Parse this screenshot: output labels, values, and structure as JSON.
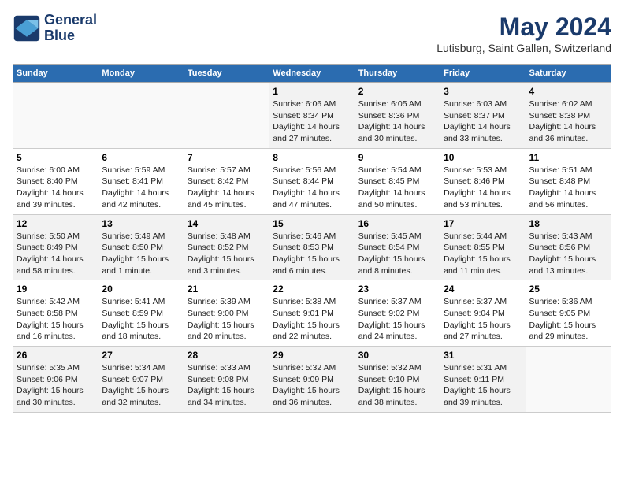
{
  "header": {
    "logo_line1": "General",
    "logo_line2": "Blue",
    "title": "May 2024",
    "subtitle": "Lutisburg, Saint Gallen, Switzerland"
  },
  "days_of_week": [
    "Sunday",
    "Monday",
    "Tuesday",
    "Wednesday",
    "Thursday",
    "Friday",
    "Saturday"
  ],
  "weeks": [
    [
      {
        "day": "",
        "info": ""
      },
      {
        "day": "",
        "info": ""
      },
      {
        "day": "",
        "info": ""
      },
      {
        "day": "1",
        "info": "Sunrise: 6:06 AM\nSunset: 8:34 PM\nDaylight: 14 hours\nand 27 minutes."
      },
      {
        "day": "2",
        "info": "Sunrise: 6:05 AM\nSunset: 8:36 PM\nDaylight: 14 hours\nand 30 minutes."
      },
      {
        "day": "3",
        "info": "Sunrise: 6:03 AM\nSunset: 8:37 PM\nDaylight: 14 hours\nand 33 minutes."
      },
      {
        "day": "4",
        "info": "Sunrise: 6:02 AM\nSunset: 8:38 PM\nDaylight: 14 hours\nand 36 minutes."
      }
    ],
    [
      {
        "day": "5",
        "info": "Sunrise: 6:00 AM\nSunset: 8:40 PM\nDaylight: 14 hours\nand 39 minutes."
      },
      {
        "day": "6",
        "info": "Sunrise: 5:59 AM\nSunset: 8:41 PM\nDaylight: 14 hours\nand 42 minutes."
      },
      {
        "day": "7",
        "info": "Sunrise: 5:57 AM\nSunset: 8:42 PM\nDaylight: 14 hours\nand 45 minutes."
      },
      {
        "day": "8",
        "info": "Sunrise: 5:56 AM\nSunset: 8:44 PM\nDaylight: 14 hours\nand 47 minutes."
      },
      {
        "day": "9",
        "info": "Sunrise: 5:54 AM\nSunset: 8:45 PM\nDaylight: 14 hours\nand 50 minutes."
      },
      {
        "day": "10",
        "info": "Sunrise: 5:53 AM\nSunset: 8:46 PM\nDaylight: 14 hours\nand 53 minutes."
      },
      {
        "day": "11",
        "info": "Sunrise: 5:51 AM\nSunset: 8:48 PM\nDaylight: 14 hours\nand 56 minutes."
      }
    ],
    [
      {
        "day": "12",
        "info": "Sunrise: 5:50 AM\nSunset: 8:49 PM\nDaylight: 14 hours\nand 58 minutes."
      },
      {
        "day": "13",
        "info": "Sunrise: 5:49 AM\nSunset: 8:50 PM\nDaylight: 15 hours\nand 1 minute."
      },
      {
        "day": "14",
        "info": "Sunrise: 5:48 AM\nSunset: 8:52 PM\nDaylight: 15 hours\nand 3 minutes."
      },
      {
        "day": "15",
        "info": "Sunrise: 5:46 AM\nSunset: 8:53 PM\nDaylight: 15 hours\nand 6 minutes."
      },
      {
        "day": "16",
        "info": "Sunrise: 5:45 AM\nSunset: 8:54 PM\nDaylight: 15 hours\nand 8 minutes."
      },
      {
        "day": "17",
        "info": "Sunrise: 5:44 AM\nSunset: 8:55 PM\nDaylight: 15 hours\nand 11 minutes."
      },
      {
        "day": "18",
        "info": "Sunrise: 5:43 AM\nSunset: 8:56 PM\nDaylight: 15 hours\nand 13 minutes."
      }
    ],
    [
      {
        "day": "19",
        "info": "Sunrise: 5:42 AM\nSunset: 8:58 PM\nDaylight: 15 hours\nand 16 minutes."
      },
      {
        "day": "20",
        "info": "Sunrise: 5:41 AM\nSunset: 8:59 PM\nDaylight: 15 hours\nand 18 minutes."
      },
      {
        "day": "21",
        "info": "Sunrise: 5:39 AM\nSunset: 9:00 PM\nDaylight: 15 hours\nand 20 minutes."
      },
      {
        "day": "22",
        "info": "Sunrise: 5:38 AM\nSunset: 9:01 PM\nDaylight: 15 hours\nand 22 minutes."
      },
      {
        "day": "23",
        "info": "Sunrise: 5:37 AM\nSunset: 9:02 PM\nDaylight: 15 hours\nand 24 minutes."
      },
      {
        "day": "24",
        "info": "Sunrise: 5:37 AM\nSunset: 9:04 PM\nDaylight: 15 hours\nand 27 minutes."
      },
      {
        "day": "25",
        "info": "Sunrise: 5:36 AM\nSunset: 9:05 PM\nDaylight: 15 hours\nand 29 minutes."
      }
    ],
    [
      {
        "day": "26",
        "info": "Sunrise: 5:35 AM\nSunset: 9:06 PM\nDaylight: 15 hours\nand 30 minutes."
      },
      {
        "day": "27",
        "info": "Sunrise: 5:34 AM\nSunset: 9:07 PM\nDaylight: 15 hours\nand 32 minutes."
      },
      {
        "day": "28",
        "info": "Sunrise: 5:33 AM\nSunset: 9:08 PM\nDaylight: 15 hours\nand 34 minutes."
      },
      {
        "day": "29",
        "info": "Sunrise: 5:32 AM\nSunset: 9:09 PM\nDaylight: 15 hours\nand 36 minutes."
      },
      {
        "day": "30",
        "info": "Sunrise: 5:32 AM\nSunset: 9:10 PM\nDaylight: 15 hours\nand 38 minutes."
      },
      {
        "day": "31",
        "info": "Sunrise: 5:31 AM\nSunset: 9:11 PM\nDaylight: 15 hours\nand 39 minutes."
      },
      {
        "day": "",
        "info": ""
      }
    ]
  ]
}
